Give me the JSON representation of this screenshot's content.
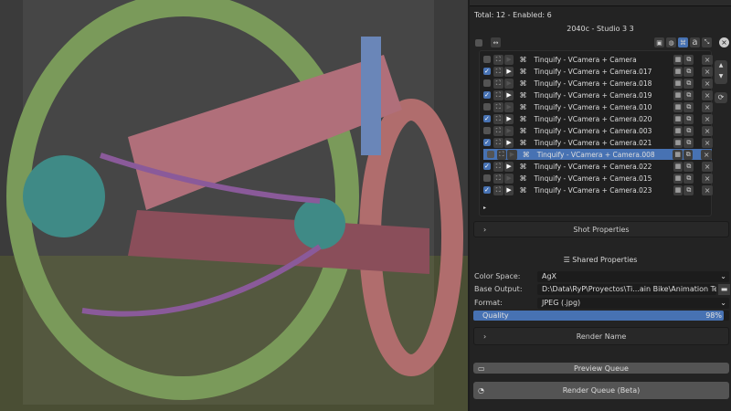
{
  "panel": {
    "summary": "Total: 12 - Enabled: 6",
    "scene": "2040c - Studio 3 3",
    "cameras": [
      {
        "name": "Tinquify - VCamera + Camera",
        "enabled": false
      },
      {
        "name": "Tinquify - VCamera + Camera.017",
        "enabled": true
      },
      {
        "name": "Tinquify - VCamera + Camera.018",
        "enabled": false
      },
      {
        "name": "Tinquify - VCamera + Camera.019",
        "enabled": true
      },
      {
        "name": "Tinquify - VCamera + Camera.010",
        "enabled": false
      },
      {
        "name": "Tinquify - VCamera + Camera.020",
        "enabled": true
      },
      {
        "name": "Tinquify - VCamera + Camera.003",
        "enabled": false
      },
      {
        "name": "Tinquify - VCamera + Camera.021",
        "enabled": true
      },
      {
        "name": "Tinquify - VCamera + Camera.008",
        "enabled": false,
        "selected": true
      },
      {
        "name": "Tinquify - VCamera + Camera.022",
        "enabled": true
      },
      {
        "name": "Tinquify - VCamera + Camera.015",
        "enabled": false
      },
      {
        "name": "Tinquify - VCamera + Camera.023",
        "enabled": true
      }
    ],
    "shot_properties": "Shot Properties",
    "shared_properties": "Shared Properties",
    "color_space_label": "Color Space:",
    "color_space": "AgX",
    "base_output_label": "Base Output:",
    "base_output": "D:\\Data\\RyP\\Proyectos\\Ti...ain Bike\\Animation Test 2\\",
    "format_label": "Format:",
    "format": "JPEG (.jpg)",
    "quality_label": "Quality",
    "quality": "98%",
    "quality_value": 98,
    "render_name": "Render Name",
    "preview_queue": "Preview Queue",
    "render_queue": "Render Queue (Beta)"
  },
  "colors": {
    "accent": "#4772b3",
    "panel": "#232323"
  }
}
